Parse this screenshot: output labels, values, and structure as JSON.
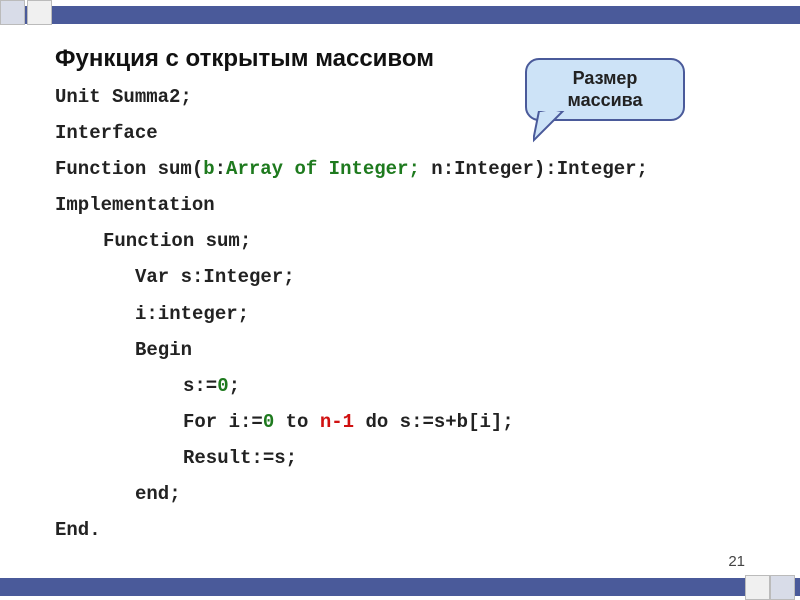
{
  "title": "Функция с открытым массивом",
  "callout": {
    "line1": "Размер",
    "line2": "массива"
  },
  "code": {
    "l1": "Unit Summa2;",
    "l2": "Interface",
    "l3a": " Function sum(",
    "l3b": "b",
    "l3c": ":",
    "l3d": "Array of Integer;",
    "l3e": " n:Integer):Integer;",
    "l4": "Implementation",
    "l5": "Function sum;",
    "l6": "Var s:Integer;",
    "l7": "i:integer;",
    "l8": "Begin",
    "l9a": "s:=",
    "l9b": "0",
    "l9c": ";",
    "l10a": "For i:=",
    "l10b": "0",
    "l10c": " to ",
    "l10d": "n-1",
    "l10e": " do s:=s+b[i];",
    "l11": "Result:=s;",
    "l12": "end;",
    "l13": "End."
  },
  "page_number": "21"
}
